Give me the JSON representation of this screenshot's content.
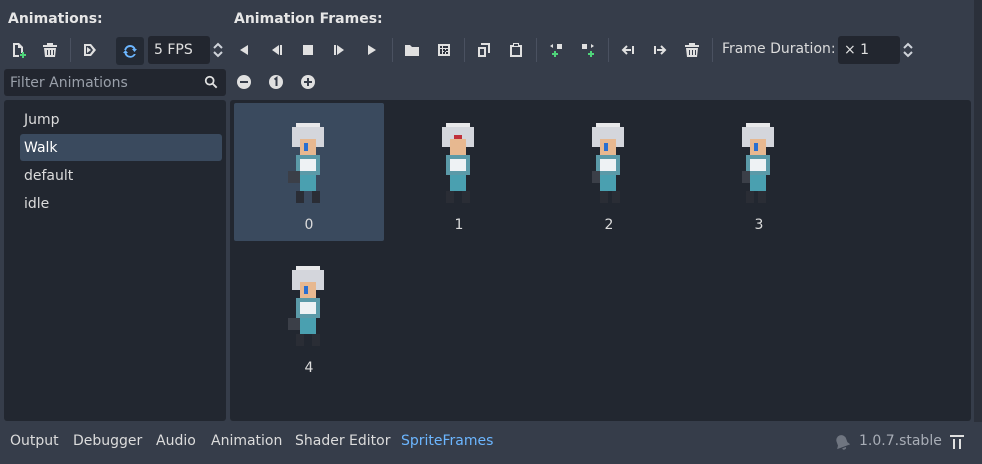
{
  "animations_panel": {
    "header": "Animations:",
    "fps_value": "5 FPS",
    "filter_placeholder": "Filter Animations",
    "items": [
      {
        "label": "Jump",
        "selected": false
      },
      {
        "label": "Walk",
        "selected": true
      },
      {
        "label": "default",
        "selected": false
      },
      {
        "label": "idle",
        "selected": false
      }
    ]
  },
  "frames_panel": {
    "header": "Animation Frames:",
    "frame_duration_label": "Frame Duration:",
    "frame_duration_value": "× 1",
    "frames": [
      {
        "label": "0",
        "selected": true
      },
      {
        "label": "1",
        "selected": false
      },
      {
        "label": "2",
        "selected": false
      },
      {
        "label": "3",
        "selected": false
      },
      {
        "label": "4",
        "selected": false
      }
    ]
  },
  "bottom_bar": {
    "tabs": [
      {
        "label": "Output",
        "active": false
      },
      {
        "label": "Debugger",
        "active": false
      },
      {
        "label": "Audio",
        "active": false
      },
      {
        "label": "Animation",
        "active": false
      },
      {
        "label": "Shader Editor",
        "active": false
      },
      {
        "label": "SpriteFrames",
        "active": true
      }
    ],
    "version": "1.0.7.stable"
  },
  "colors": {
    "accent": "#6cb6ff",
    "panel_bg": "#222730",
    "selection": "#3a4a5e",
    "add_green": "#4fd47a"
  }
}
